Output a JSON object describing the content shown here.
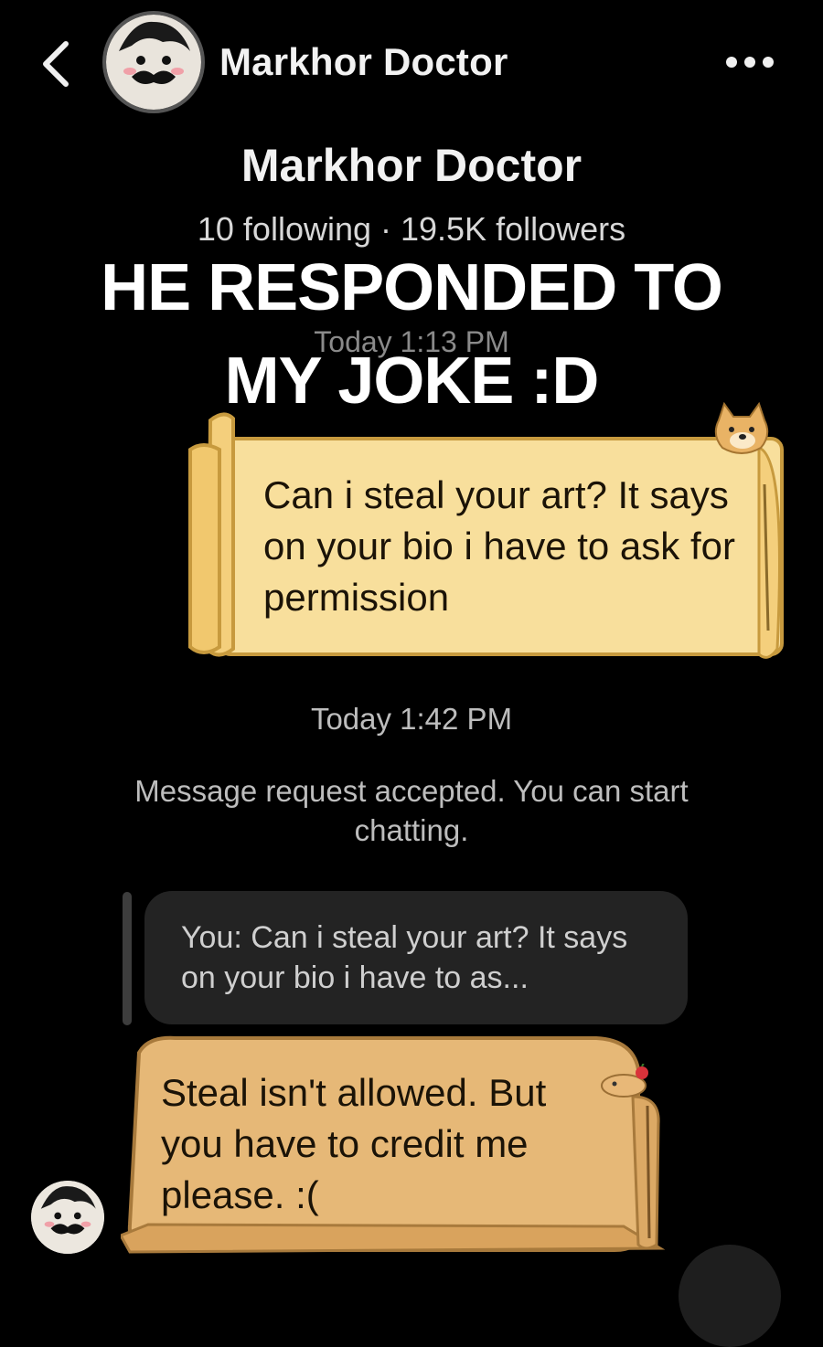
{
  "header": {
    "name": "Markhor Doctor"
  },
  "profile": {
    "name": "Markhor Doctor",
    "stats": "10 following · 19.5K followers"
  },
  "caption": {
    "line1": "HE RESPONDED TO",
    "line2": "MY JOKE :D"
  },
  "messages": {
    "first_timestamp": "Today 1:13 PM",
    "outgoing_text": "Can i steal your art? It says on your bio i have to ask for permission",
    "second_timestamp": "Today 1:42 PM",
    "system_text": "Message request accepted. You can start chatting.",
    "reply_preview": "You: Can i steal your art? It says on your bio i have to as...",
    "incoming_text": "Steal isn't allowed. But you have to credit me please. :("
  },
  "colors": {
    "scroll_outgoing": "#f8df9c",
    "scroll_incoming": "#e6b877",
    "background": "#000000"
  },
  "icons": [
    "back-chevron-icon",
    "more-dots-icon",
    "doge-icon",
    "capybara-icon"
  ]
}
